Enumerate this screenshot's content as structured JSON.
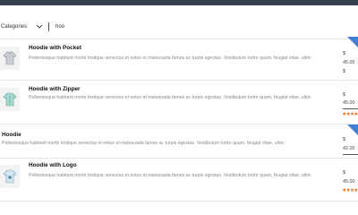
{
  "search": {
    "category_label": "Categories",
    "query": "hoo"
  },
  "results": [
    {
      "title": "Hoodie with Pocket",
      "description": "Pellentesque habitant morbi tristique senectus et netus et malesuada fames ac turpis egestas. Vestibulum tortor quam, feugiat vitae, ultric",
      "currency": "$",
      "price": "45.00",
      "old_price_symbol": "$",
      "on_sale": true
    },
    {
      "title": "Hoodie with Zipper",
      "description": "Pellentesque habitant morbi tristique senectus et netus et malesuada fames ac turpis egestas. Vestibulum tortor quam, feugiat vitae, ultric",
      "currency": "$",
      "price": "45.00",
      "rating_stars": 5
    },
    {
      "title": "Hoodie",
      "description": "Pellentesque habitant morbi tristique senectus et netus et malesuada fames ac turpis egestas. Vestibulum tortor quam, feugiat vitae, ultric",
      "currency": "$",
      "price": "42.00",
      "on_sale": true
    },
    {
      "title": "Hoodie with Logo",
      "description": "Pellentesque habitant morbi tristique senectus et netus et malesuada fames ac turpis egestas. Vestibulum tortor quam, feugiat vitae, ultric",
      "currency": "$",
      "price": "45.00",
      "rating_stars": 5
    }
  ],
  "colors": {
    "sale_ribbon": "#3f7fd6",
    "stars": "#e8741e",
    "topbar": "#34404f"
  }
}
